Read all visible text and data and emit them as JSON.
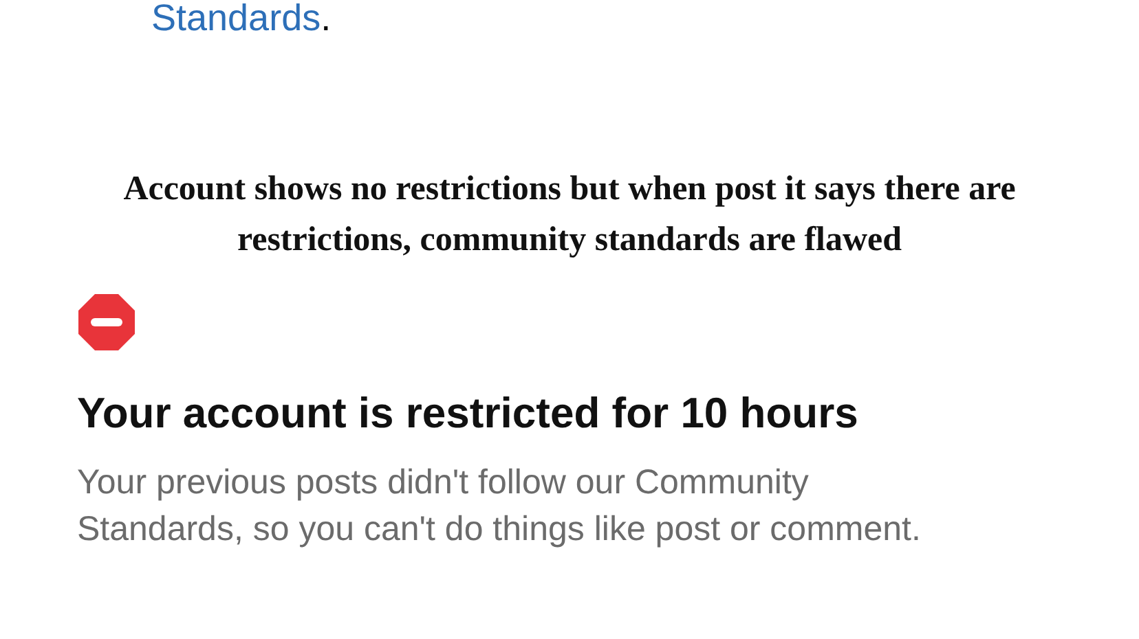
{
  "previous_text": {
    "link": "Standards",
    "rest": "."
  },
  "caption": "Account shows no restrictions but when post it says there are restrictions, community standards are flawed",
  "notice": {
    "title": "Your account is restricted for 10 hours",
    "message": "Your previous posts didn't follow our Community Standards, so you can't do things like post or comment."
  }
}
